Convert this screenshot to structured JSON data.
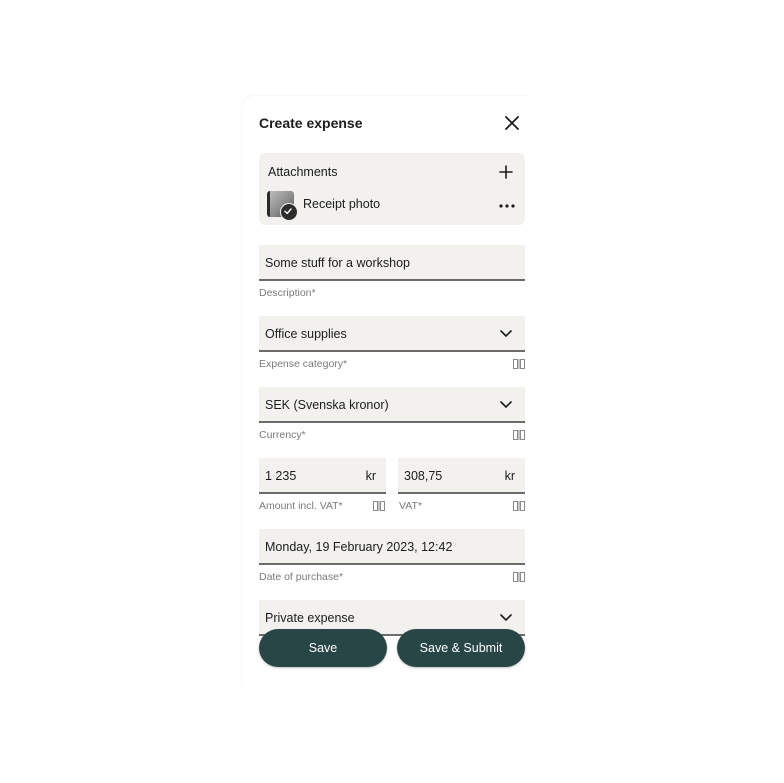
{
  "dialog": {
    "title": "Create expense",
    "close_icon": "close-icon"
  },
  "attachments": {
    "title": "Attachments",
    "add_icon": "plus-icon",
    "items": [
      {
        "name": "Receipt photo",
        "status_icon": "check-circle-icon",
        "menu_icon": "more-horizontal-icon"
      }
    ]
  },
  "fields": {
    "description": {
      "value": "Some stuff for a workshop",
      "label": "Description*"
    },
    "category": {
      "value": "Office supplies",
      "label": "Expense category*",
      "icon": "chevron-down-icon"
    },
    "currency": {
      "value": "SEK (Svenska kronor)",
      "label": "Currency*",
      "icon": "chevron-down-icon"
    },
    "amount": {
      "value": "1 235",
      "unit": "kr",
      "label": "Amount incl. VAT*"
    },
    "vat": {
      "value": "308,75",
      "unit": "kr",
      "label": "VAT*"
    },
    "date": {
      "value": "Monday, 19 February 2023, 12:42",
      "label": "Date of purchase*"
    },
    "expense_type": {
      "value": "Private expense",
      "icon": "chevron-down-icon"
    }
  },
  "actions": {
    "save": "Save",
    "save_submit": "Save & Submit"
  },
  "colors": {
    "primary_button": "#284646",
    "field_background": "#f2f1ee"
  }
}
